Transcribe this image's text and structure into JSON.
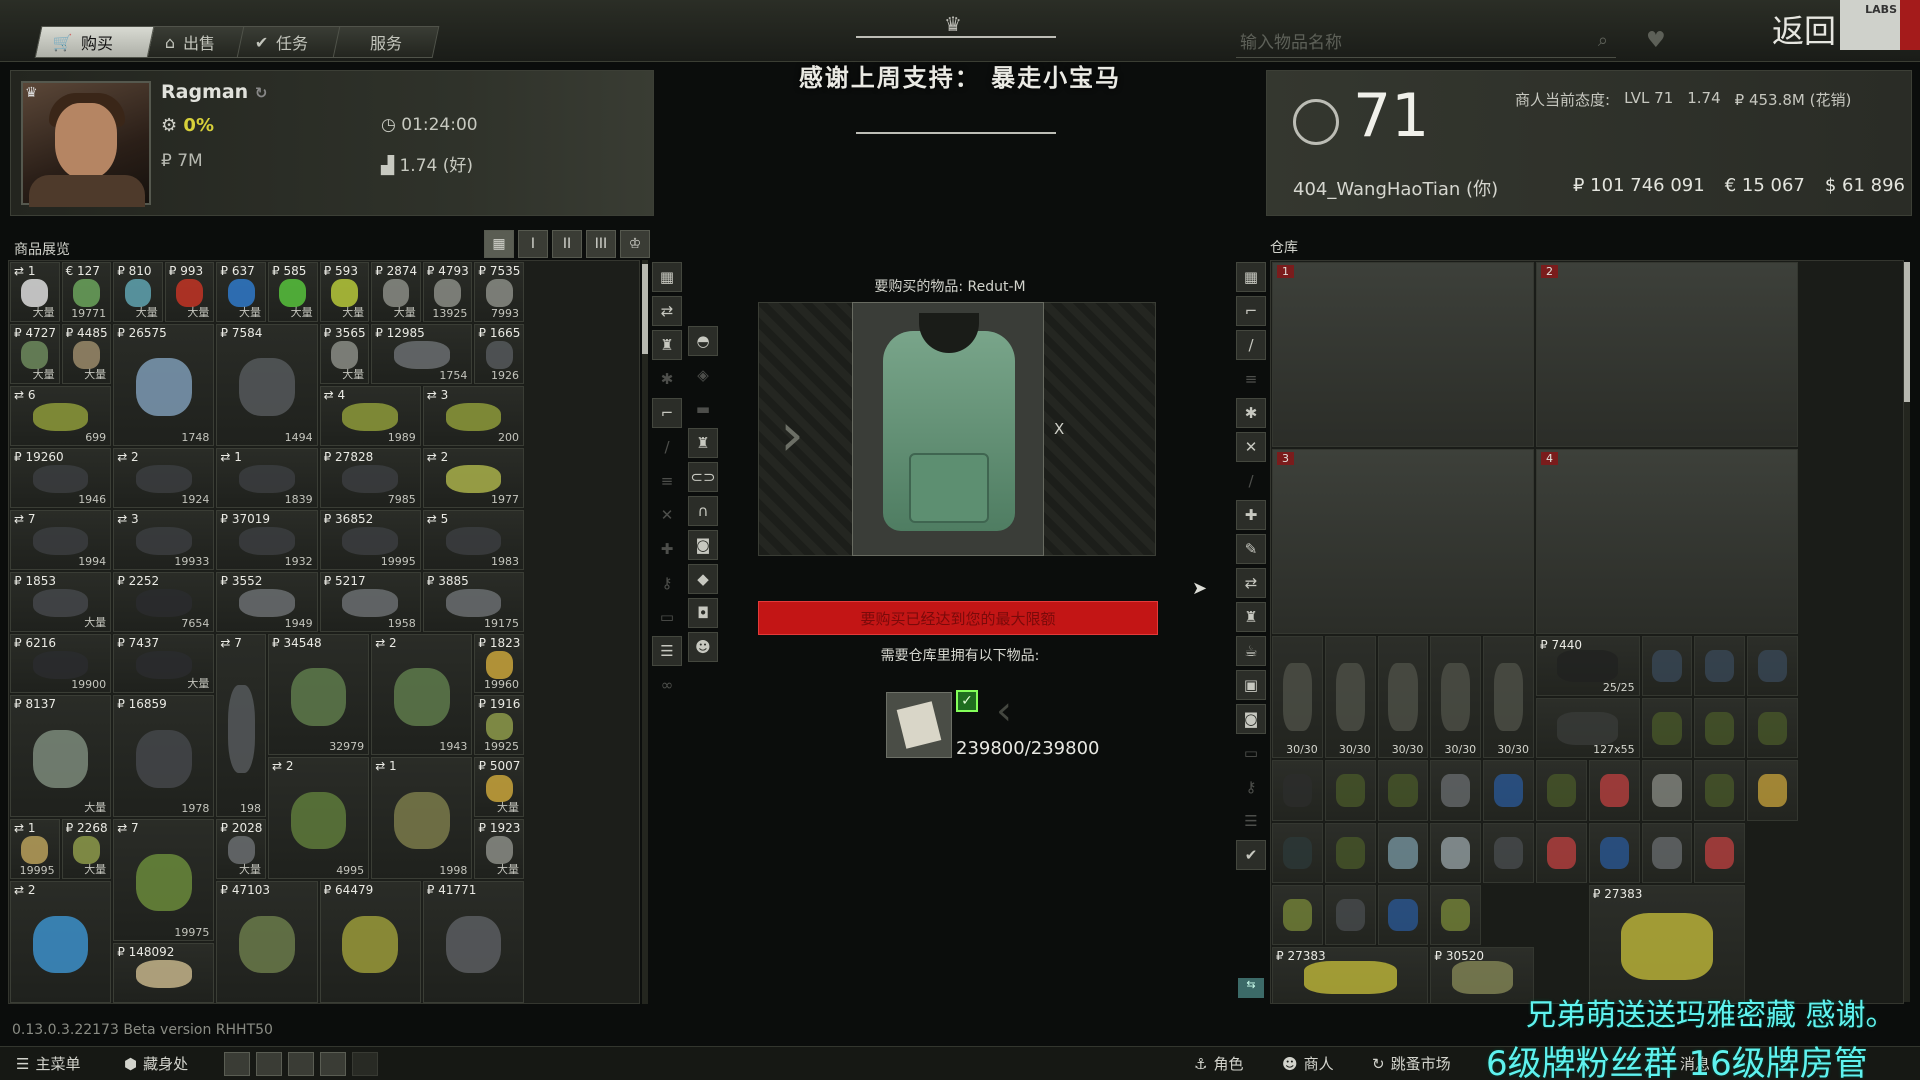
{
  "top_tabs": [
    {
      "label": "购买",
      "icon": "cart-icon",
      "active": true
    },
    {
      "label": "出售",
      "icon": "basket-icon",
      "active": false
    },
    {
      "label": "任务",
      "icon": "check-icon",
      "active": false
    },
    {
      "label": "服务",
      "icon": "",
      "active": false
    }
  ],
  "search": {
    "placeholder": "输入物品名称"
  },
  "back_label": "返回",
  "corner_logo": "LABS",
  "trader": {
    "name": "Ragman",
    "discount": "0%",
    "money": "₽ 7M",
    "timer": "01:24:00",
    "reputation": "1.74 (好)"
  },
  "banner": "感谢上周支持： 暴走小宝马",
  "player": {
    "level": "71",
    "name": "404_WangHaoTian (你)",
    "attitude_label": "商人当前态度:",
    "attitude_level": "LVL 71",
    "attitude_rep": "1.74",
    "attitude_spent": "₽ 453.8M (花销)",
    "rub": "₽ 101 746 091",
    "eur": "€ 15 067",
    "usd": "$ 61 896"
  },
  "goods": {
    "header": "商品展览",
    "view_buttons": [
      "▦",
      "I",
      "II",
      "III",
      "♔"
    ],
    "cells": [
      {
        "p": "⇄ 1",
        "q": "大量",
        "color": "#dcdcdc"
      },
      {
        "p": "€ 127",
        "q": "19771",
        "color": "#6ba35c"
      },
      {
        "p": "₽ 810",
        "q": "大量",
        "color": "#5fa3b0"
      },
      {
        "p": "₽ 993",
        "q": "大量",
        "color": "#c23424"
      },
      {
        "p": "₽ 637",
        "q": "大量",
        "color": "#2f79c9"
      },
      {
        "p": "₽ 585",
        "q": "大量",
        "color": "#57c23c"
      },
      {
        "p": "₽ 593",
        "q": "大量",
        "color": "#b6c83a"
      },
      {
        "p": "₽ 2874",
        "q": "大量",
        "color": "#8a8c85"
      },
      {
        "p": "₽ 4793",
        "q": "13925",
        "color": "#8a8c85"
      },
      {
        "p": "₽ 7535",
        "q": "7993",
        "color": "#8a8c85"
      },
      {
        "p": "₽ 4727",
        "q": "大量",
        "color": "#6d8a5d"
      },
      {
        "p": "₽ 4485",
        "q": "大量",
        "color": "#9a8a6a"
      },
      {
        "p": "₽ 26575",
        "q": "1748",
        "color": "#7d9ab4"
      },
      {
        "p": "₽ 7584",
        "q": "1494",
        "color": "#55585a"
      },
      {
        "p": "₽ 3565",
        "q": "大量",
        "color": "#8a8c85"
      },
      {
        "p": "₽ 12985",
        "q": "1754",
        "color": "#6a6d70"
      },
      {
        "p": "₽ 1665",
        "q": "1926",
        "color": "#55585a"
      },
      {
        "p": "⇄ 6",
        "q": "699",
        "color": "#8d9a3a"
      },
      {
        "p": "⇄ 4",
        "q": "1989",
        "color": "#8d9a3a"
      },
      {
        "p": "⇄ 3",
        "q": "200",
        "color": "#8d9a3a"
      },
      {
        "p": "₽ 19260",
        "q": "1946",
        "color": "#3b3d3f"
      },
      {
        "p": "⇄ 2",
        "q": "1924",
        "color": "#3b3d3f"
      },
      {
        "p": "⇄ 1",
        "q": "1839",
        "color": "#3b3d3f"
      },
      {
        "p": "₽ 27828",
        "q": "7985",
        "color": "#3b3d3f"
      },
      {
        "p": "⇄ 2",
        "q": "1977",
        "color": "#a9b04a"
      },
      {
        "p": "⇄ 7",
        "q": "1994",
        "color": "#3b3d3f"
      },
      {
        "p": "⇄ 3",
        "q": "19933",
        "color": "#3b3d3f"
      },
      {
        "p": "₽ 37019",
        "q": "1932",
        "color": "#3b3d3f"
      },
      {
        "p": "₽ 36852",
        "q": "19995",
        "color": "#3b3d3f"
      },
      {
        "p": "⇄ 5",
        "q": "1983",
        "color": "#3b3d3f"
      },
      {
        "p": "₽ 1853",
        "q": "大量",
        "color": "#44474a"
      },
      {
        "p": "₽ 2252",
        "q": "7654",
        "color": "#2a2c2e"
      },
      {
        "p": "₽ 3552",
        "q": "1949",
        "color": "#6a6d70"
      },
      {
        "p": "₽ 5217",
        "q": "1958",
        "color": "#6a6d70"
      },
      {
        "p": "₽ 3885",
        "q": "19175",
        "color": "#6a6d70"
      },
      {
        "p": "₽ 6216",
        "q": "19900",
        "color": "#2a2c2e"
      },
      {
        "p": "₽ 7437",
        "q": "大量",
        "color": "#2a2c2e"
      },
      {
        "p": "⇄ 7",
        "q": "198",
        "color": "#55585a"
      },
      {
        "p": "₽ 34548",
        "q": "32979",
        "color": "#5e7a4b"
      },
      {
        "p": "⇄ 2",
        "q": "1943",
        "color": "#5e7a4b"
      },
      {
        "p": "₽ 1823",
        "q": "19960",
        "color": "#c9a43b"
      },
      {
        "p": "₽ 8137",
        "q": "大量",
        "color": "#7b8a7a"
      },
      {
        "p": "₽ 16859",
        "q": "1978",
        "color": "#44474a"
      },
      {
        "p": "₽ 1916",
        "q": "19925",
        "color": "#8d9a4a"
      },
      {
        "p": "⇄ 2",
        "q": "4995",
        "color": "#5e7a3b"
      },
      {
        "p": "⇄ 1",
        "q": "1998",
        "color": "#7a7a4a"
      },
      {
        "p": "₽ 5007",
        "q": "大量",
        "color": "#c9a43b"
      },
      {
        "p": "⇄ 1",
        "q": "19995",
        "color": "#b8a05a"
      },
      {
        "p": "₽ 2268",
        "q": "大量",
        "color": "#8d9a4a"
      },
      {
        "p": "⇄ 7",
        "q": "19975",
        "color": "#6a8a3b"
      },
      {
        "p": "₽ 2028",
        "q": "大量",
        "color": "#6a6d70"
      },
      {
        "p": "₽ 1923",
        "q": "大量",
        "color": "#8a8c85"
      },
      {
        "p": "⇄ 2",
        "q": "",
        "color": "#3c8fc9"
      },
      {
        "p": "₽ 148092",
        "q": "",
        "color": "#c4b48a"
      },
      {
        "p": "₽ 47103",
        "q": "",
        "color": "#6a7a4a"
      },
      {
        "p": "₽ 64479",
        "q": "",
        "color": "#9a9a3a"
      },
      {
        "p": "₽ 41771",
        "q": "",
        "color": "#5a5d60"
      }
    ]
  },
  "purchase": {
    "title": "要购买的物品: Redut-M",
    "x_mark": "X",
    "warning": "要购买已经达到您的最大限额",
    "need_label": "需要仓库里拥有以下物品:",
    "need_count": "239800/239800",
    "vest_color": "#5f9677"
  },
  "stash": {
    "header": "仓库",
    "case_numbers": [
      "1",
      "2",
      "3",
      "4"
    ],
    "cells": [
      {
        "p": "",
        "q": "30/30",
        "color": "#505349"
      },
      {
        "p": "",
        "q": "30/30",
        "color": "#505349"
      },
      {
        "p": "",
        "q": "30/30",
        "color": "#505349"
      },
      {
        "p": "",
        "q": "30/30",
        "color": "#505349"
      },
      {
        "p": "",
        "q": "30/30",
        "color": "#505349"
      },
      {
        "p": "₽ 7440",
        "q": "25/25",
        "color": "#202220"
      },
      {
        "p": "",
        "q": "",
        "color": "#3a4a5a"
      },
      {
        "p": "",
        "q": "",
        "color": "#3a4a5a"
      },
      {
        "p": "",
        "q": "",
        "color": "#3a4a5a"
      },
      {
        "p": "",
        "q": "127x55",
        "color": "#3a3c3a"
      },
      {
        "p": "",
        "q": "",
        "color": "#4a5a2a"
      },
      {
        "p": "",
        "q": "",
        "color": "#4a5a2a"
      },
      {
        "p": "",
        "q": "",
        "color": "#4a5a2a"
      },
      {
        "p": "",
        "q": "",
        "color": "#2c2e2c"
      },
      {
        "p": "",
        "q": "",
        "color": "#4a5a2a"
      },
      {
        "p": "",
        "q": "",
        "color": "#4a5a2a"
      },
      {
        "p": "",
        "q": "",
        "color": "#6a6d70"
      },
      {
        "p": "",
        "q": "",
        "color": "#2a5a9a"
      },
      {
        "p": "",
        "q": "",
        "color": "#4a5a2a"
      },
      {
        "p": "",
        "q": "",
        "color": "#c04040"
      },
      {
        "p": "",
        "q": "",
        "color": "#8a8c85"
      },
      {
        "p": "",
        "q": "",
        "color": "#4a5a2a"
      },
      {
        "p": "",
        "q": "",
        "color": "#c9a43b"
      },
      {
        "p": "",
        "q": "",
        "color": "#2c3a3a"
      },
      {
        "p": "",
        "q": "",
        "color": "#4a5a2a"
      },
      {
        "p": "",
        "q": "",
        "color": "#7a9aa5"
      },
      {
        "p": "",
        "q": "",
        "color": "#9aa5aa"
      },
      {
        "p": "",
        "q": "",
        "color": "#4a4d50"
      },
      {
        "p": "",
        "q": "",
        "color": "#c04040"
      },
      {
        "p": "",
        "q": "",
        "color": "#2a5a9a"
      },
      {
        "p": "",
        "q": "",
        "color": "#6a6d70"
      },
      {
        "p": "",
        "q": "",
        "color": "#c04040"
      },
      {
        "p": "",
        "q": "",
        "color": "#7a8a3a"
      },
      {
        "p": "",
        "q": "",
        "color": "#4a4d50"
      },
      {
        "p": "",
        "q": "",
        "color": "#2a5a9a"
      },
      {
        "p": "",
        "q": "",
        "color": "#7a8a3a"
      },
      {
        "p": "₽ 27383",
        "q": "",
        "color": "#c9c23b"
      },
      {
        "p": "₽ 27383",
        "q": "",
        "color": "#c9c23b"
      },
      {
        "p": "₽ 30520",
        "q": "",
        "color": "#8a8c5a"
      }
    ]
  },
  "version": "0.13.0.3.22173 Beta version RHHT50",
  "bottom": {
    "main_menu": "主菜单",
    "hideout": "藏身处",
    "character": "角色",
    "traders": "商人",
    "flea": "跳蚤市场",
    "messages": "消息"
  },
  "overlay": {
    "line1": "兄弟萌送送玛雅密藏 感谢。",
    "line2": "6级牌粉丝群 16级牌房管"
  }
}
